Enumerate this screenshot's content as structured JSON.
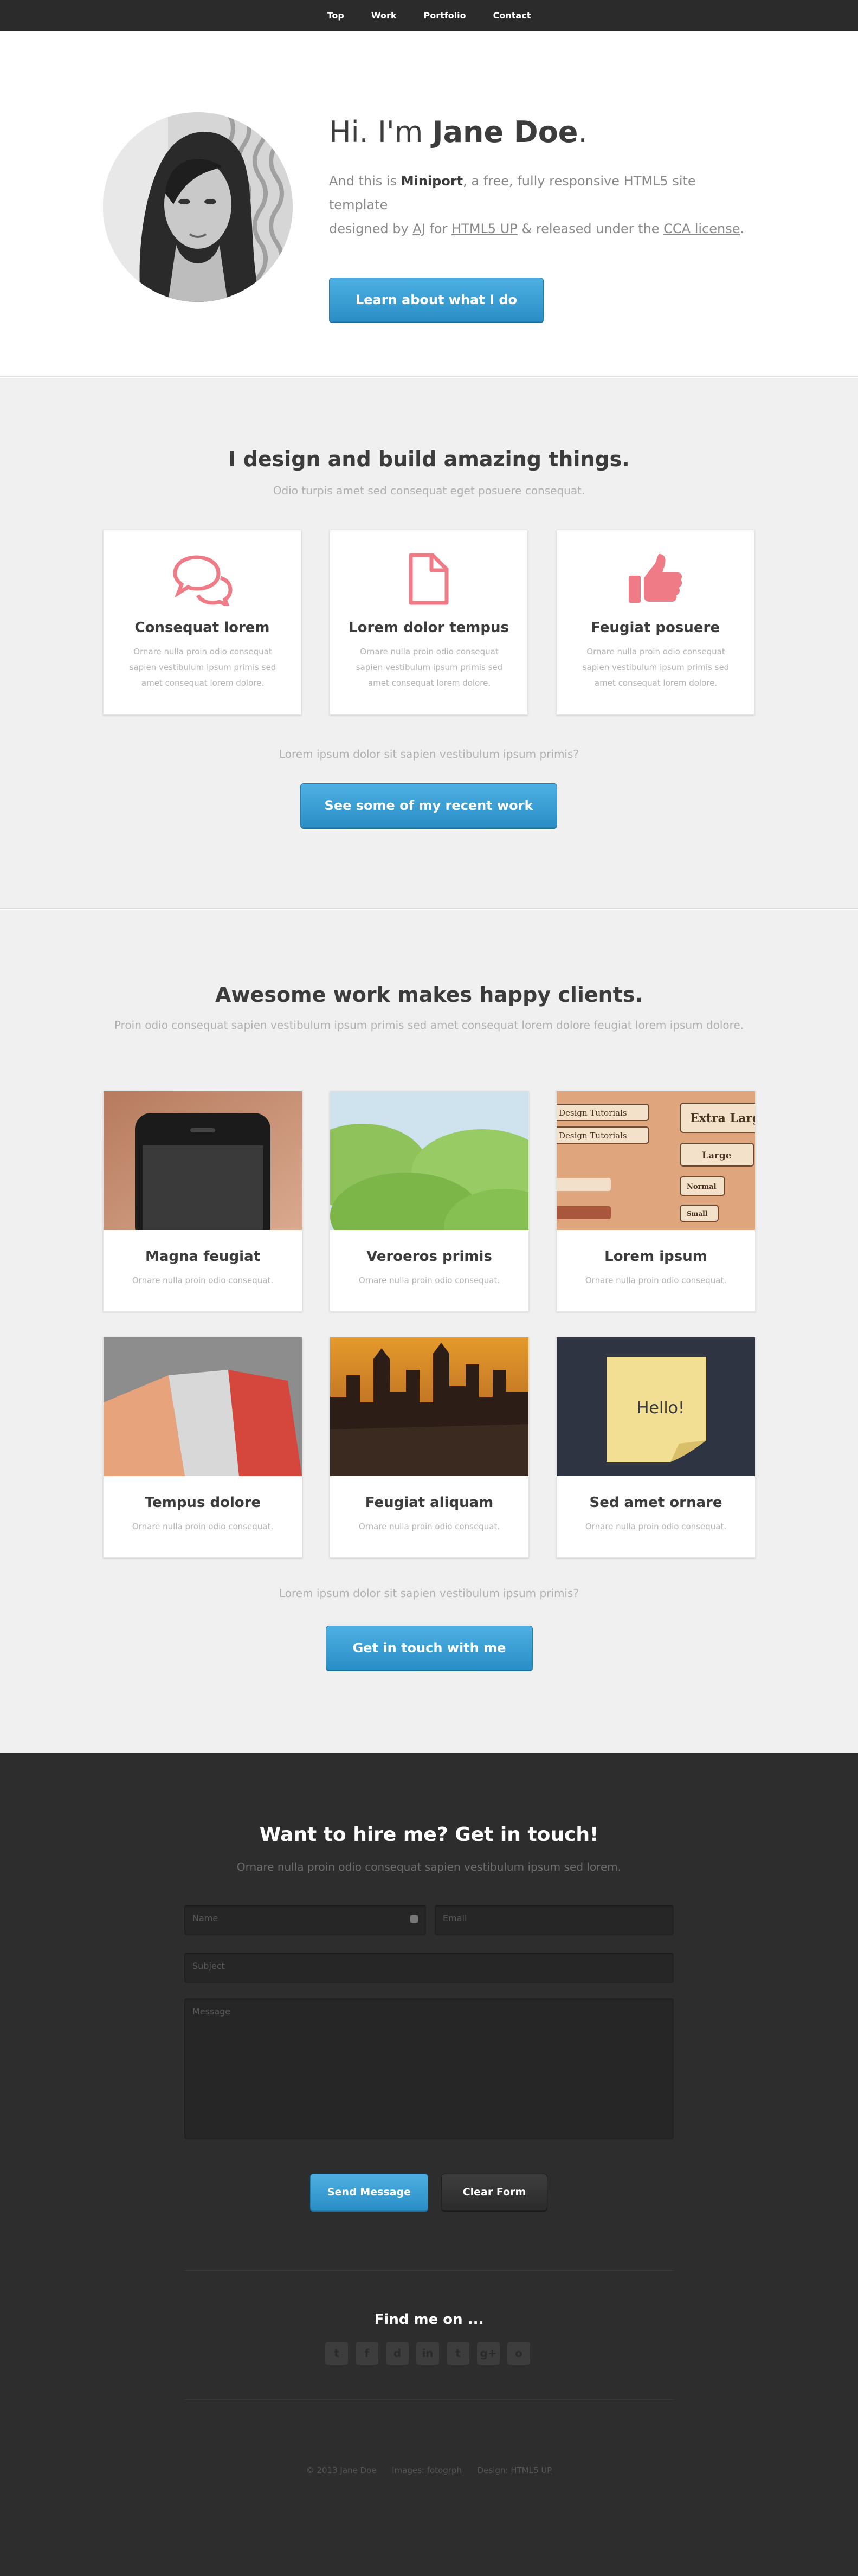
{
  "nav": {
    "items": [
      "Top",
      "Work",
      "Portfolio",
      "Contact"
    ]
  },
  "hero": {
    "greeting": "Hi. I'm",
    "name": "Jane Doe",
    "period": ".",
    "intro_1": "And this is",
    "site_name": "Miniport",
    "intro_2": ", a free, fully responsive HTML5 site template",
    "intro_3": "designed by",
    "author_link": "AJ",
    "intro_4": "for",
    "html5up_link": "HTML5 UP",
    "intro_5": "& released under the",
    "license_link": "CCA license",
    "intro_6": ".",
    "button": "Learn about what I do"
  },
  "features": {
    "title": "I design and build amazing things.",
    "subtitle": "Odio turpis amet sed consequat eget posuere consequat.",
    "cards": [
      {
        "icon": "speech-bubbles-icon",
        "title": "Consequat lorem",
        "text": "Ornare nulla proin odio consequat sapien vestibulum ipsum primis sed amet consequat lorem dolore."
      },
      {
        "icon": "document-icon",
        "title": "Lorem dolor tempus",
        "text": "Ornare nulla proin odio consequat sapien vestibulum ipsum primis sed amet consequat lorem dolore."
      },
      {
        "icon": "thumbs-up-icon",
        "title": "Feugiat posuere",
        "text": "Ornare nulla proin odio consequat sapien vestibulum ipsum primis sed amet consequat lorem dolore."
      }
    ],
    "footer_text": "Lorem ipsum dolor sit sapien vestibulum ipsum primis?",
    "button": "See some of my recent work"
  },
  "portfolio": {
    "title": "Awesome work makes happy clients.",
    "subtitle": "Proin odio consequat sapien vestibulum ipsum primis sed amet consequat lorem dolore feugiat lorem ipsum dolore.",
    "items": [
      {
        "title": "Magna feugiat",
        "text": "Ornare nulla proin odio consequat."
      },
      {
        "title": "Veroeros primis",
        "text": "Ornare nulla proin odio consequat."
      },
      {
        "title": "Lorem ipsum",
        "text": "Ornare nulla proin odio consequat."
      },
      {
        "title": "Tempus dolore",
        "text": "Ornare nulla proin odio consequat."
      },
      {
        "title": "Feugiat aliquam",
        "text": "Ornare nulla proin odio consequat."
      },
      {
        "title": "Sed amet ornare",
        "text": "Ornare nulla proin odio consequat."
      }
    ],
    "thumb3_labels": {
      "select_1": "Design Tutorials",
      "select_2": "Design Tutorials",
      "btn_xl": "Extra Large",
      "btn_l": "Large",
      "btn_n": "Normal",
      "btn_s": "Small"
    },
    "thumb6_note": "Hello!",
    "footer_text": "Lorem ipsum dolor sit sapien vestibulum ipsum primis?",
    "button": "Get in touch with me"
  },
  "contact": {
    "title": "Want to hire me? Get in touch!",
    "subtitle": "Ornare nulla proin odio consequat sapien vestibulum ipsum sed lorem.",
    "name_placeholder": "Name",
    "email_placeholder": "Email",
    "subject_placeholder": "Subject",
    "message_placeholder": "Message",
    "send_button": "Send Message",
    "clear_button": "Clear Form",
    "find_me": "Find me on ...",
    "social_icons": [
      "twitter-icon",
      "facebook-icon",
      "dribbble-icon",
      "linkedin-icon",
      "tumblr-icon",
      "googleplus-icon",
      "github-icon"
    ],
    "social_glyphs": [
      "t",
      "f",
      "d",
      "in",
      "t",
      "g+",
      "o"
    ]
  },
  "footer": {
    "copyright": "© 2013 Jane Doe",
    "images_label": "Images:",
    "images_link": "fotogrph",
    "design_label": "Design:",
    "design_link": "HTML5 UP"
  }
}
